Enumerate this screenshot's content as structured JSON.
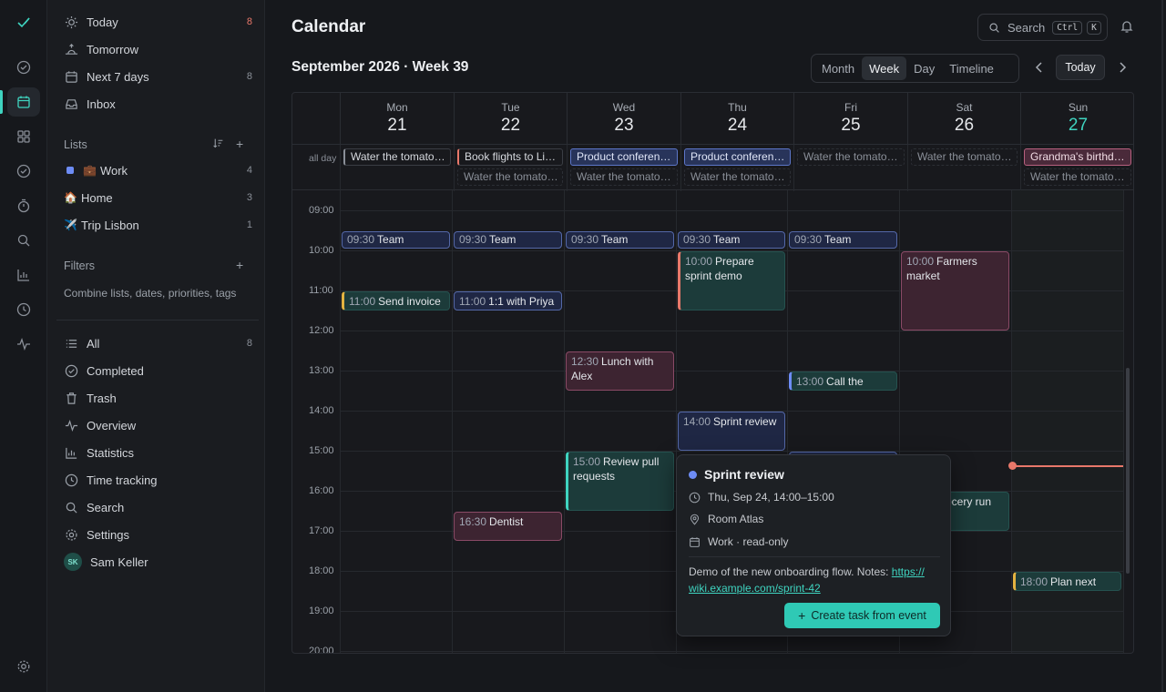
{
  "sidebar": {
    "nav": [
      {
        "label": "Today",
        "count": "8",
        "icon": "sun-icon"
      },
      {
        "label": "Tomorrow",
        "count": "",
        "icon": "sunrise-icon"
      },
      {
        "label": "Next 7 days",
        "count": "8",
        "icon": "calendar-icon"
      },
      {
        "label": "Inbox",
        "count": "",
        "icon": "inbox-icon"
      }
    ],
    "lists_label": "Lists",
    "lists": [
      {
        "emoji": "💼",
        "label": "Work",
        "count": "4",
        "color": "#6d8cf5"
      },
      {
        "emoji": "🏠",
        "label": "Home",
        "count": "3"
      },
      {
        "emoji": "✈️",
        "label": "Trip Lisbon",
        "count": "1"
      }
    ],
    "filters_label": "Filters",
    "filters_hint": "Combine lists, dates, priorities, tags",
    "bottom": [
      {
        "label": "All",
        "count": "8",
        "icon": "list-icon"
      },
      {
        "label": "Completed",
        "count": "",
        "icon": "check-circle-icon"
      },
      {
        "label": "Trash",
        "count": "",
        "icon": "trash-icon"
      },
      {
        "label": "Overview",
        "count": "",
        "icon": "activity-icon"
      },
      {
        "label": "Statistics",
        "count": "",
        "icon": "bar-chart-icon"
      },
      {
        "label": "Time tracking",
        "count": "",
        "icon": "clock-icon"
      },
      {
        "label": "Search",
        "count": "",
        "icon": "search-icon"
      },
      {
        "label": "Settings",
        "count": "",
        "icon": "gear-icon"
      }
    ],
    "user": {
      "initials": "SK",
      "name": "Sam Keller"
    }
  },
  "header": {
    "title": "Calendar",
    "search_label": "Search",
    "search_kbd1": "Ctrl",
    "search_kbd2": "K",
    "subtitle": "September 2026 · Week 39",
    "views": [
      "Month",
      "Week",
      "Day",
      "Timeline"
    ],
    "active_view": "Week",
    "today_label": "Today"
  },
  "calendar": {
    "allday_label": "all day",
    "days": [
      {
        "name": "Mon",
        "date": "21"
      },
      {
        "name": "Tue",
        "date": "22"
      },
      {
        "name": "Wed",
        "date": "23"
      },
      {
        "name": "Thu",
        "date": "24"
      },
      {
        "name": "Fri",
        "date": "25"
      },
      {
        "name": "Sat",
        "date": "26"
      },
      {
        "name": "Sun",
        "date": "27",
        "today": true
      }
    ],
    "hours": [
      "09:00",
      "10:00",
      "11:00",
      "12:00",
      "13:00",
      "14:00",
      "15:00",
      "16:00",
      "17:00",
      "18:00",
      "19:00",
      "20:00"
    ],
    "allday_events": [
      {
        "text": "Water the tomato…",
        "style": "plain"
      },
      {
        "text": "Book flights to Li…",
        "style": "red"
      },
      {
        "text": "Water the tomato…",
        "style": "ghost"
      },
      {
        "text": "Product conferen…",
        "style": "blue"
      },
      {
        "text": "Water the tomato…",
        "style": "ghost"
      },
      {
        "text": "Product conferen…",
        "style": "blue"
      },
      {
        "text": "Water the tomato…",
        "style": "ghost"
      },
      {
        "text": "Water the tomato…",
        "style": "ghost"
      },
      {
        "text": "Water the tomato…",
        "style": "ghost"
      },
      {
        "text": "Grandma's birthd…",
        "style": "pink"
      },
      {
        "text": "Water the tomato…",
        "style": "ghost"
      }
    ],
    "events": [
      {
        "time": "09:30",
        "title": "Team"
      },
      {
        "time": "09:30",
        "title": "Team"
      },
      {
        "time": "09:30",
        "title": "Team"
      },
      {
        "time": "09:30",
        "title": "Team"
      },
      {
        "time": "09:30",
        "title": "Team"
      },
      {
        "time": "11:00",
        "title": "Send invoice"
      },
      {
        "time": "11:00",
        "title": "1:1 with Priya"
      },
      {
        "time": "10:00",
        "title": "Prepare sprint demo"
      },
      {
        "time": "10:00",
        "title": "Farmers market"
      },
      {
        "time": "12:30",
        "title": "Lunch with Alex"
      },
      {
        "time": "13:00",
        "title": "Call the"
      },
      {
        "time": "14:00",
        "title": "Sprint review"
      },
      {
        "time": "15:00",
        "title": "Review pull requests"
      },
      {
        "time": "16:30",
        "title": "Dentist"
      },
      {
        "time": "",
        "title": "ocery run"
      },
      {
        "time": "18:00",
        "title": "Plan next"
      }
    ]
  },
  "popover": {
    "title": "Sprint review",
    "when": "Thu, Sep 24, 14:00–15:00",
    "where": "Room Atlas",
    "calendar": "Work · read-only",
    "desc_prefix": "Demo of the new onboarding flow. Notes: ",
    "link": "https://wiki.example.com/sprint-42",
    "link_line1": "https://",
    "link_line2": "wiki.example.com/sprint-42",
    "button": "Create task from event",
    "dot_color": "#6d8cf5"
  }
}
